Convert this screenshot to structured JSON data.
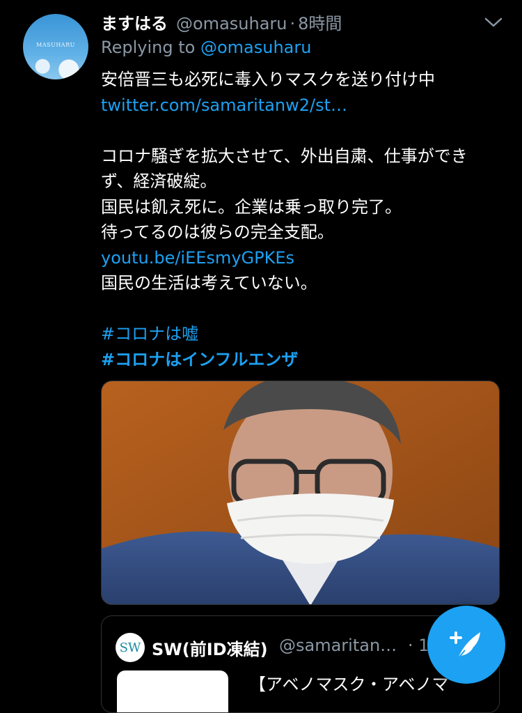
{
  "tweet": {
    "avatar_text": "MASUHARU",
    "name": "ますはる",
    "handle": "@omasuharu",
    "separator": "·",
    "time": "8時間",
    "reply_prefix": "Replying to",
    "reply_to": "@omasuharu",
    "lines": [
      "安倍晋三も必死に毒入りマスクを送り付け中",
      "twitter.com/samaritanw2/st…",
      "",
      "コロナ騒ぎを拡大させて、外出自粛、仕事ができ",
      "ず、経済破綻。",
      "国民は飢え死に。企業は乗っ取り完了。",
      "待ってるのは彼らの完全支配。",
      "youtu.be/iEEsmyGPKEs",
      "国民の生活は考えていない。",
      "",
      "#コロナは嘘",
      "#コロナはインフルエンザ"
    ]
  },
  "quote": {
    "logo_text": "SW",
    "name": "SW(前ID凍結)",
    "handle": "@samaritan…",
    "time": "· 1",
    "text": "【アベノマスク・アベノマ"
  },
  "colors": {
    "accent": "#1da1f2",
    "muted": "#8b98a5",
    "background": "#000000"
  }
}
